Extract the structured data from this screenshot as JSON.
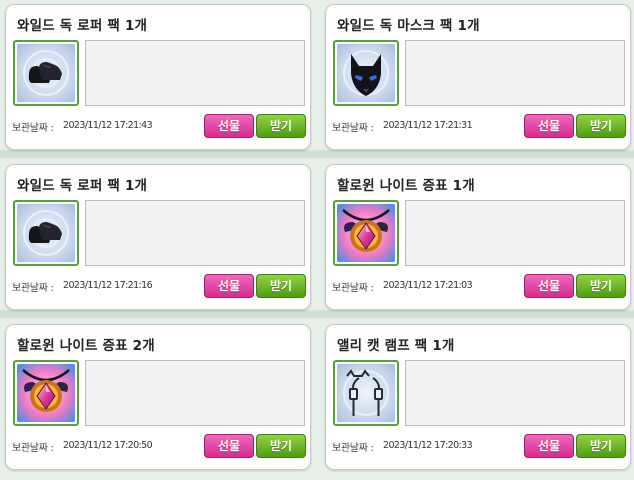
{
  "cards": [
    {
      "title": "와일드 독 로퍼 팩 1개",
      "icon": "black-loafer-shoes-icon",
      "date_label": "보관날짜 :",
      "date": "2023/11/12 17:21:43",
      "gift_label": "선물",
      "receive_label": "받기"
    },
    {
      "title": "와일드 독 마스크 팩 1개",
      "icon": "wolf-mask-icon",
      "date_label": "보관날짜 :",
      "date": "2023/11/12 17:21:31",
      "gift_label": "선물",
      "receive_label": "받기"
    },
    {
      "title": "와일드 독 로퍼 팩 1개",
      "icon": "black-loafer-shoes-icon",
      "date_label": "보관날짜 :",
      "date": "2023/11/12 17:21:16",
      "gift_label": "선물",
      "receive_label": "받기"
    },
    {
      "title": "할로윈 나이트 증표 1개",
      "icon": "halloween-night-token-icon",
      "date_label": "보관날짜 :",
      "date": "2023/11/12 17:21:03",
      "gift_label": "선물",
      "receive_label": "받기"
    },
    {
      "title": "할로윈 나이트 증표 2개",
      "icon": "halloween-night-token-icon",
      "date_label": "보관날짜 :",
      "date": "2023/11/12 17:20:50",
      "gift_label": "선물",
      "receive_label": "받기"
    },
    {
      "title": "앨리 캣 램프 팩 1개",
      "icon": "alley-cat-lamp-icon",
      "date_label": "보관날짜 :",
      "date": "2023/11/12 17:20:33",
      "gift_label": "선물",
      "receive_label": "받기"
    }
  ],
  "colors": {
    "gift_button": "#e0449f",
    "receive_button": "#6cb92a",
    "icon_border": "#5aa03a"
  }
}
